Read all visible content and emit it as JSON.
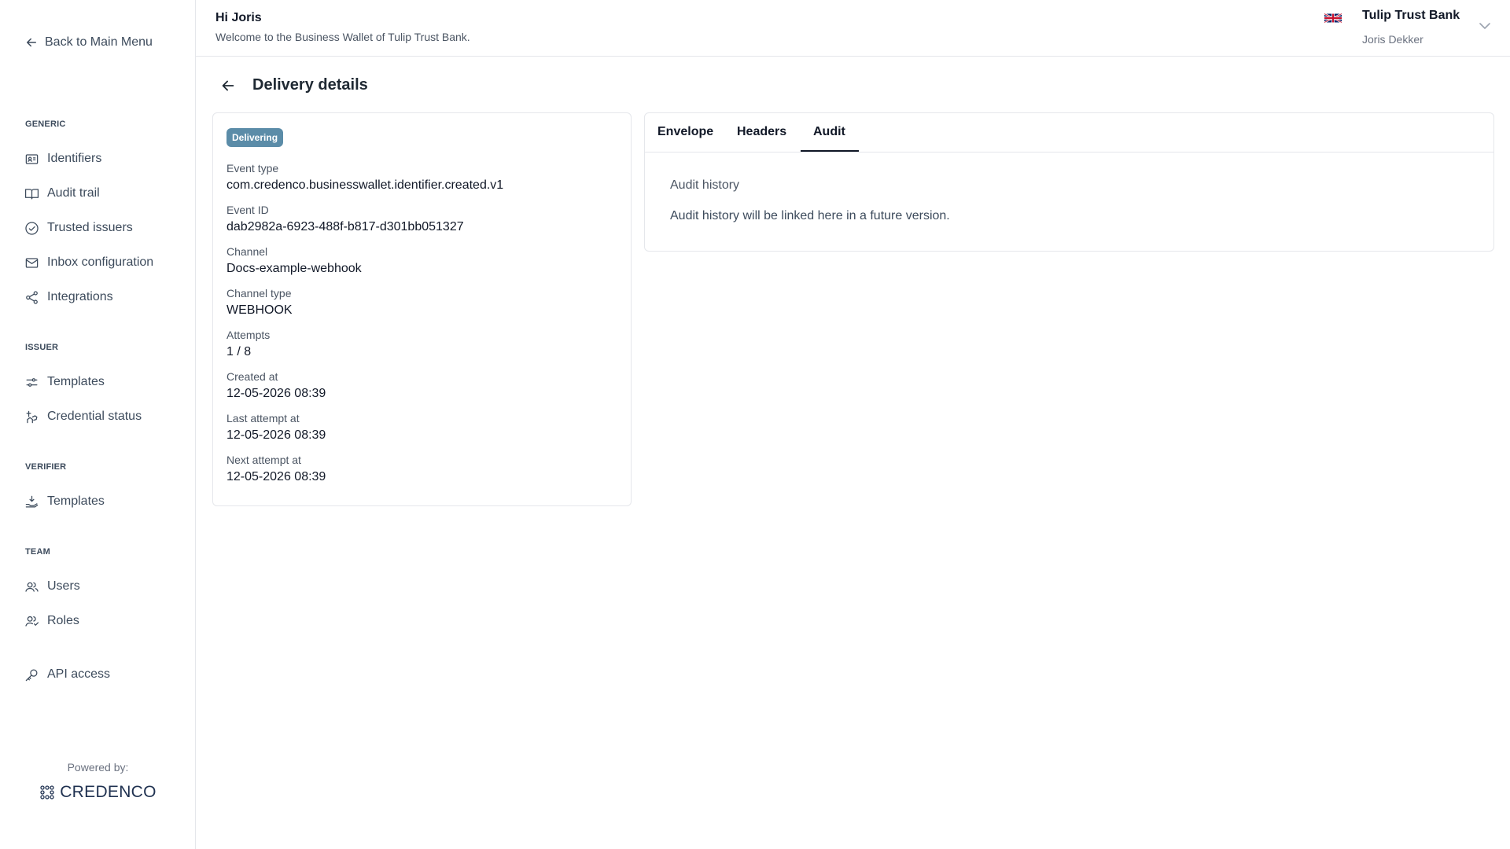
{
  "sidebar": {
    "back_label": "Back to Main Menu",
    "sections": {
      "generic": "GENERIC",
      "issuer": "ISSUER",
      "verifier": "VERIFIER",
      "team": "TEAM"
    },
    "items": {
      "identifiers": "Identifiers",
      "audit_trail": "Audit trail",
      "trusted_issuers": "Trusted issuers",
      "inbox_configuration": "Inbox configuration",
      "integrations": "Integrations",
      "issuer_templates": "Templates",
      "credential_status": "Credential status",
      "verifier_templates": "Templates",
      "users": "Users",
      "roles": "Roles",
      "api_access": "API access"
    },
    "powered_by": "Powered by:",
    "brand": "CREDENCO"
  },
  "header": {
    "greeting": "Hi Joris",
    "welcome": "Welcome to the Business Wallet of Tulip Trust Bank.",
    "org_name": "Tulip Trust Bank",
    "user_name": "Joris Dekker"
  },
  "page": {
    "title": "Delivery details"
  },
  "details": {
    "status_badge": "Delivering",
    "fields": [
      {
        "label": "Event type",
        "value": "com.credenco.businesswallet.identifier.created.v1"
      },
      {
        "label": "Event ID",
        "value": "dab2982a-6923-488f-b817-d301bb051327"
      },
      {
        "label": "Channel",
        "value": "Docs-example-webhook"
      },
      {
        "label": "Channel type",
        "value": "WEBHOOK"
      },
      {
        "label": "Attempts",
        "value": "1 / 8"
      },
      {
        "label": "Created at",
        "value": "12-05-2026 08:39"
      },
      {
        "label": "Last attempt at",
        "value": "12-05-2026 08:39"
      },
      {
        "label": "Next attempt at",
        "value": "12-05-2026 08:39"
      }
    ]
  },
  "tabs": {
    "items": [
      "Envelope",
      "Headers",
      "Audit"
    ],
    "active": "Audit",
    "audit_title": "Audit history",
    "audit_text": "Audit history will be linked here in a future version."
  },
  "colors": {
    "badge": "#5b8ca8",
    "border": "#e5e7eb",
    "text": "#111827"
  }
}
